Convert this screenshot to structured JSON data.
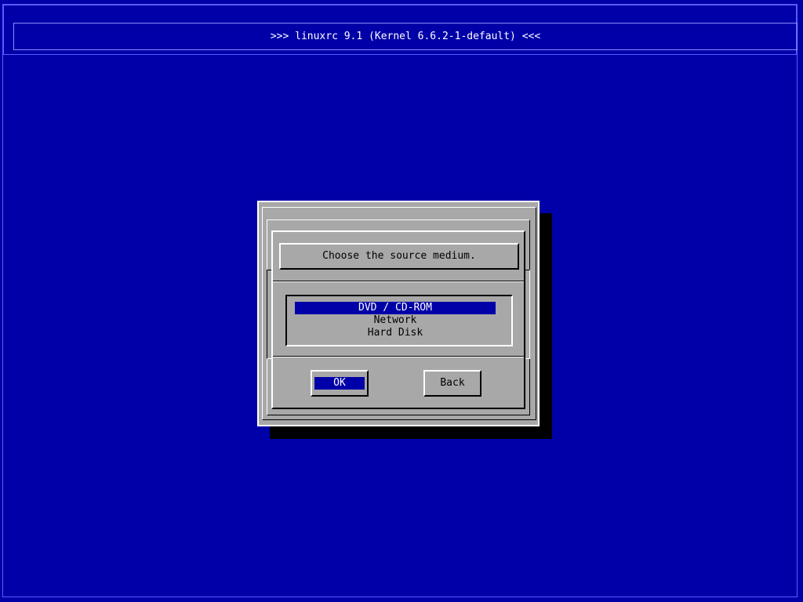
{
  "title_bar": {
    "text": ">>> linuxrc 9.1 (Kernel 6.6.2-1-default) <<<"
  },
  "dialog": {
    "title": "Choose the source medium.",
    "items": [
      {
        "label": "DVD / CD-ROM",
        "selected": true
      },
      {
        "label": "Network",
        "selected": false
      },
      {
        "label": "Hard Disk",
        "selected": false
      }
    ],
    "buttons": {
      "ok": "OK",
      "back": "Back"
    }
  },
  "colors": {
    "background": "#0000a8",
    "dialog": "#a8a8a8",
    "highlight": "#0000a8",
    "text": "#000000"
  }
}
